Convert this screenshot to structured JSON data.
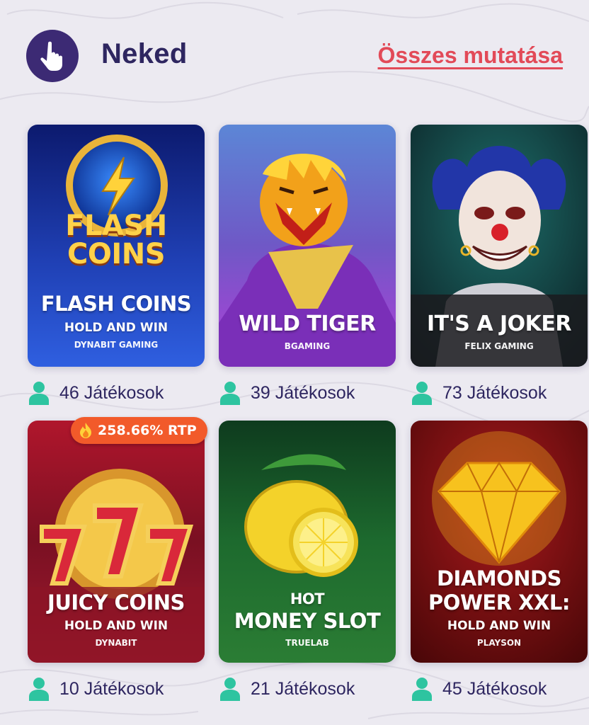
{
  "section": {
    "title": "Neked",
    "show_all_label": "Összes mutatása"
  },
  "games": [
    {
      "name": "FLASH COINS",
      "subtitle": "HOLD AND WIN",
      "provider": "DYNABIT GAMING",
      "players": "46 Játékosok",
      "art_text_line1": "FLASH",
      "art_text_line2": "COINS"
    },
    {
      "name": "WILD TIGER",
      "subtitle": "",
      "provider": "BGAMING",
      "players": "39 Játékosok"
    },
    {
      "name": "IT'S A JOKER",
      "subtitle": "",
      "provider": "FELIX GAMING",
      "players": "73 Játékosok"
    },
    {
      "name": "JUICY COINS",
      "subtitle": "HOLD AND WIN",
      "provider": "DYNABIT",
      "players": "10 Játékosok",
      "badge": "258.66% RTP"
    },
    {
      "name_line1": "HOT",
      "name_line2": "MONEY SLOT",
      "provider": "TRUELAB",
      "players": "21 Játékosok"
    },
    {
      "name_line1": "DIAMONDS",
      "name_line2": "POWER XXL:",
      "subtitle": "HOLD AND WIN",
      "provider": "PLAYSON",
      "players": "45 Játékosok"
    }
  ],
  "colors": {
    "accent": "#e24a58",
    "title": "#2e2660",
    "player_icon": "#2ec4a0",
    "badge": "#f25a2a"
  },
  "icons": {
    "section": "pointing-hand-icon",
    "players": "person-icon",
    "badge": "flame-icon"
  }
}
